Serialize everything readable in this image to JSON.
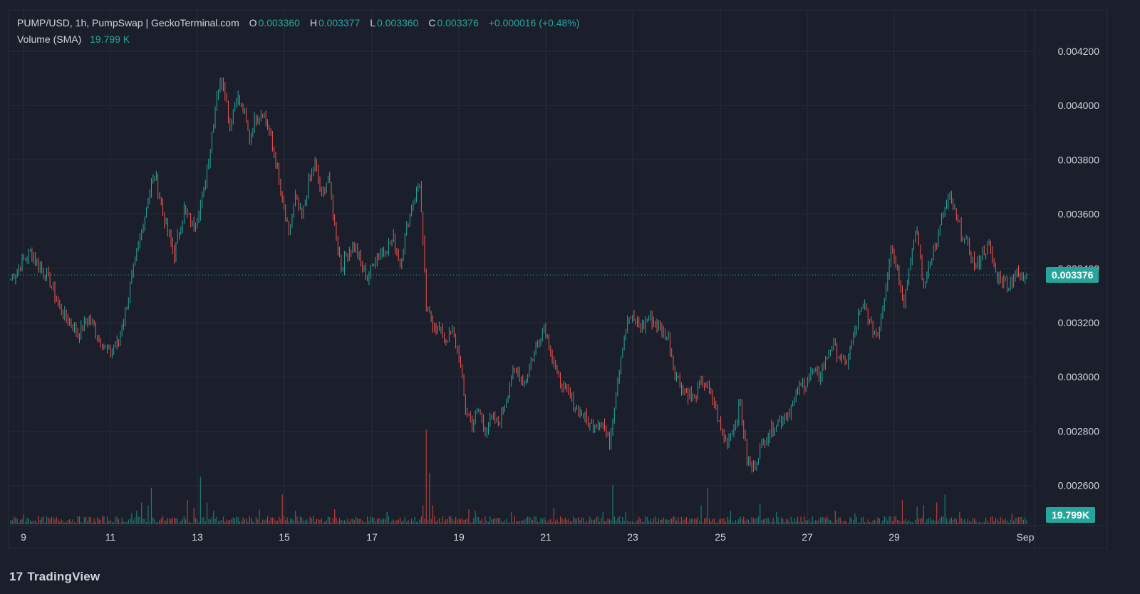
{
  "header": {
    "symbol": "PUMP/USD, 1h, PumpSwap | GeckoTerminal.com",
    "open_key": "O",
    "open": "0.003360",
    "high_key": "H",
    "high": "0.003377",
    "low_key": "L",
    "low": "0.003360",
    "close_key": "C",
    "close": "0.003376",
    "change": "+0.000016 (+0.48%)",
    "volume_label": "Volume (SMA)",
    "volume_value": "19.799 K"
  },
  "colors": {
    "background": "#1b1f2b",
    "up": "#26a69a",
    "down": "#ef5350",
    "grid": "#272c38",
    "text": "#d1d4dc"
  },
  "branding": {
    "logo_mark": "17",
    "logo_text": "TradingView"
  },
  "chart_data": {
    "type": "candlestick",
    "y_axis_ticks": [
      "0.004200",
      "0.004000",
      "0.003800",
      "0.003600",
      "0.003400",
      "0.003200",
      "0.003000",
      "0.002800",
      "0.002600"
    ],
    "ylim": [
      0.00252,
      0.00432
    ],
    "x_axis_ticks": [
      "9",
      "11",
      "13",
      "15",
      "17",
      "19",
      "21",
      "23",
      "25",
      "27",
      "29",
      "Sep"
    ],
    "last_price_label": "0.003376",
    "last_price": 0.003376,
    "volume_tag": "19.799K",
    "price_path": [
      [
        0,
        0.00336
      ],
      [
        6,
        0.00341
      ],
      [
        12,
        0.00346
      ],
      [
        18,
        0.00341
      ],
      [
        24,
        0.00335
      ],
      [
        30,
        0.00325
      ],
      [
        36,
        0.0032
      ],
      [
        42,
        0.00316
      ],
      [
        48,
        0.00322
      ],
      [
        54,
        0.00314
      ],
      [
        60,
        0.00309
      ],
      [
        66,
        0.00313
      ],
      [
        72,
        0.0033
      ],
      [
        78,
        0.00348
      ],
      [
        84,
        0.00366
      ],
      [
        88,
        0.00375
      ],
      [
        94,
        0.00358
      ],
      [
        100,
        0.00345
      ],
      [
        106,
        0.00362
      ],
      [
        112,
        0.00355
      ],
      [
        118,
        0.00368
      ],
      [
        122,
        0.00385
      ],
      [
        126,
        0.00405
      ],
      [
        130,
        0.0041
      ],
      [
        134,
        0.00392
      ],
      [
        138,
        0.00404
      ],
      [
        142,
        0.00398
      ],
      [
        146,
        0.00388
      ],
      [
        150,
        0.00396
      ],
      [
        154,
        0.00398
      ],
      [
        158,
        0.0039
      ],
      [
        162,
        0.00379
      ],
      [
        166,
        0.00364
      ],
      [
        170,
        0.00352
      ],
      [
        174,
        0.00366
      ],
      [
        178,
        0.00358
      ],
      [
        182,
        0.00372
      ],
      [
        186,
        0.00378
      ],
      [
        190,
        0.00366
      ],
      [
        194,
        0.00374
      ],
      [
        198,
        0.00356
      ],
      [
        202,
        0.0034
      ],
      [
        206,
        0.00346
      ],
      [
        210,
        0.00348
      ],
      [
        214,
        0.00342
      ],
      [
        218,
        0.00336
      ],
      [
        222,
        0.00343
      ],
      [
        226,
        0.00346
      ],
      [
        230,
        0.00348
      ],
      [
        234,
        0.00351
      ],
      [
        238,
        0.00342
      ],
      [
        242,
        0.00355
      ],
      [
        246,
        0.00365
      ],
      [
        250,
        0.00372
      ],
      [
        254,
        0.00325
      ],
      [
        258,
        0.0032
      ],
      [
        262,
        0.00317
      ],
      [
        266,
        0.00314
      ],
      [
        270,
        0.00316
      ],
      [
        274,
        0.00308
      ],
      [
        278,
        0.00288
      ],
      [
        282,
        0.00283
      ],
      [
        286,
        0.00288
      ],
      [
        290,
        0.0028
      ],
      [
        294,
        0.00284
      ],
      [
        298,
        0.00283
      ],
      [
        302,
        0.0029
      ],
      [
        306,
        0.003
      ],
      [
        310,
        0.00302
      ],
      [
        314,
        0.00298
      ],
      [
        318,
        0.00306
      ],
      [
        322,
        0.00312
      ],
      [
        326,
        0.00319
      ],
      [
        330,
        0.0031
      ],
      [
        334,
        0.003
      ],
      [
        338,
        0.00296
      ],
      [
        342,
        0.00292
      ],
      [
        346,
        0.00288
      ],
      [
        350,
        0.00286
      ],
      [
        354,
        0.00282
      ],
      [
        358,
        0.00284
      ],
      [
        362,
        0.00283
      ],
      [
        366,
        0.00275
      ],
      [
        370,
        0.00295
      ],
      [
        374,
        0.00312
      ],
      [
        378,
        0.00322
      ],
      [
        382,
        0.0032
      ],
      [
        386,
        0.00318
      ],
      [
        390,
        0.00322
      ],
      [
        394,
        0.0032
      ],
      [
        398,
        0.00317
      ],
      [
        402,
        0.00314
      ],
      [
        406,
        0.00302
      ],
      [
        410,
        0.00296
      ],
      [
        414,
        0.00294
      ],
      [
        418,
        0.00292
      ],
      [
        422,
        0.00298
      ],
      [
        426,
        0.00296
      ],
      [
        430,
        0.0029
      ],
      [
        434,
        0.0028
      ],
      [
        438,
        0.00276
      ],
      [
        442,
        0.00282
      ],
      [
        446,
        0.0029
      ],
      [
        450,
        0.0027
      ],
      [
        454,
        0.00266
      ],
      [
        458,
        0.00274
      ],
      [
        462,
        0.00278
      ],
      [
        466,
        0.00282
      ],
      [
        470,
        0.00284
      ],
      [
        474,
        0.00286
      ],
      [
        478,
        0.0029
      ],
      [
        482,
        0.00296
      ],
      [
        486,
        0.00298
      ],
      [
        490,
        0.00302
      ],
      [
        494,
        0.003
      ],
      [
        498,
        0.00306
      ],
      [
        502,
        0.00312
      ],
      [
        506,
        0.00308
      ],
      [
        510,
        0.00304
      ],
      [
        514,
        0.00312
      ],
      [
        518,
        0.00322
      ],
      [
        522,
        0.00326
      ],
      [
        526,
        0.00318
      ],
      [
        530,
        0.00316
      ],
      [
        534,
        0.0033
      ],
      [
        538,
        0.00348
      ],
      [
        542,
        0.0034
      ],
      [
        546,
        0.00328
      ],
      [
        550,
        0.00344
      ],
      [
        554,
        0.00354
      ],
      [
        558,
        0.00332
      ],
      [
        562,
        0.00344
      ],
      [
        566,
        0.0035
      ],
      [
        570,
        0.0036
      ],
      [
        574,
        0.00366
      ],
      [
        578,
        0.00358
      ],
      [
        582,
        0.00352
      ],
      [
        586,
        0.00346
      ],
      [
        590,
        0.0034
      ],
      [
        594,
        0.00346
      ],
      [
        598,
        0.00348
      ],
      [
        602,
        0.00338
      ],
      [
        606,
        0.00336
      ],
      [
        610,
        0.00334
      ],
      [
        614,
        0.00338
      ],
      [
        618,
        0.00336
      ],
      [
        621,
        0.00338
      ]
    ],
    "volume_spikes": [
      [
        8,
        0.07
      ],
      [
        74,
        0.08
      ],
      [
        77,
        0.1
      ],
      [
        80,
        0.16
      ],
      [
        84,
        0.14
      ],
      [
        86,
        0.27
      ],
      [
        108,
        0.18
      ],
      [
        112,
        0.12
      ],
      [
        116,
        0.35
      ],
      [
        120,
        0.16
      ],
      [
        124,
        0.1
      ],
      [
        152,
        0.11
      ],
      [
        166,
        0.22
      ],
      [
        174,
        0.1
      ],
      [
        198,
        0.11
      ],
      [
        230,
        0.09
      ],
      [
        252,
        0.14
      ],
      [
        254,
        0.7
      ],
      [
        256,
        0.38
      ],
      [
        258,
        0.14
      ],
      [
        280,
        0.11
      ],
      [
        284,
        0.1
      ],
      [
        306,
        0.09
      ],
      [
        332,
        0.12
      ],
      [
        362,
        0.09
      ],
      [
        368,
        0.29
      ],
      [
        376,
        0.09
      ],
      [
        422,
        0.14
      ],
      [
        426,
        0.27
      ],
      [
        440,
        0.1
      ],
      [
        458,
        0.15
      ],
      [
        468,
        0.09
      ],
      [
        504,
        0.1
      ],
      [
        516,
        0.08
      ],
      [
        545,
        0.18
      ],
      [
        554,
        0.13
      ],
      [
        558,
        0.14
      ],
      [
        566,
        0.16
      ],
      [
        571,
        0.22
      ],
      [
        580,
        0.09
      ],
      [
        612,
        0.08
      ]
    ]
  }
}
